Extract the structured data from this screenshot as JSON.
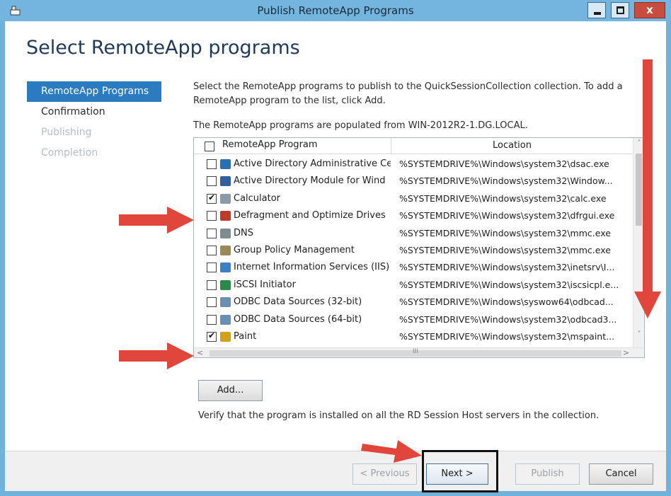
{
  "window": {
    "title": "Publish RemoteApp Programs",
    "close_glyph": "x"
  },
  "page": {
    "heading": "Select RemoteApp programs"
  },
  "nav": {
    "items": [
      {
        "label": "RemoteApp Programs",
        "state": "selected"
      },
      {
        "label": "Confirmation",
        "state": "normal"
      },
      {
        "label": "Publishing",
        "state": "disabled"
      },
      {
        "label": "Completion",
        "state": "disabled"
      }
    ]
  },
  "content": {
    "description": "Select the RemoteApp programs to publish to the QuickSessionCollection collection. To add a RemoteApp program to the list, click Add.",
    "populated_from": "The RemoteApp programs are populated from WIN-2012R2-1.DG.LOCAL.",
    "verify_note": "Verify that the program is installed on all the RD Session Host servers in the collection."
  },
  "table": {
    "columns": [
      "RemoteApp Program",
      "Location"
    ],
    "rows": [
      {
        "name": "Active Directory Administrative Ce",
        "location": "%SYSTEMDRIVE%\\Windows\\system32\\dsac.exe",
        "checked": false,
        "icon": "ad-admin-center-icon",
        "icon_color": "#2b6fb6"
      },
      {
        "name": "Active Directory Module for Wind",
        "location": "%SYSTEMDRIVE%\\Windows\\system32\\Window...",
        "checked": false,
        "icon": "powershell-module-icon",
        "icon_color": "#2f5f9e"
      },
      {
        "name": "Calculator",
        "location": "%SYSTEMDRIVE%\\Windows\\system32\\calc.exe",
        "checked": true,
        "icon": "calculator-icon",
        "icon_color": "#8a9aa8"
      },
      {
        "name": "Defragment and Optimize Drives",
        "location": "%SYSTEMDRIVE%\\Windows\\system32\\dfrgui.exe",
        "checked": false,
        "icon": "defrag-icon",
        "icon_color": "#c0392b"
      },
      {
        "name": "DNS",
        "location": "%SYSTEMDRIVE%\\Windows\\system32\\mmc.exe",
        "checked": false,
        "icon": "dns-icon",
        "icon_color": "#7f8c8d"
      },
      {
        "name": "Group Policy Management",
        "location": "%SYSTEMDRIVE%\\Windows\\system32\\mmc.exe",
        "checked": false,
        "icon": "group-policy-icon",
        "icon_color": "#9a8a5a"
      },
      {
        "name": "Internet Information Services (IIS)",
        "location": "%SYSTEMDRIVE%\\Windows\\system32\\inetsrv\\I...",
        "checked": false,
        "icon": "iis-icon",
        "icon_color": "#3b7fc4"
      },
      {
        "name": "iSCSI Initiator",
        "location": "%SYSTEMDRIVE%\\Windows\\system32\\iscsicpl.e...",
        "checked": false,
        "icon": "iscsi-icon",
        "icon_color": "#2a8a4a"
      },
      {
        "name": "ODBC Data Sources (32-bit)",
        "location": "%SYSTEMDRIVE%\\Windows\\syswow64\\odbcad...",
        "checked": false,
        "icon": "odbc-icon",
        "icon_color": "#6a8fb0"
      },
      {
        "name": "ODBC Data Sources (64-bit)",
        "location": "%SYSTEMDRIVE%\\Windows\\system32\\odbcad3...",
        "checked": false,
        "icon": "odbc-icon",
        "icon_color": "#6a8fb0"
      },
      {
        "name": "Paint",
        "location": "%SYSTEMDRIVE%\\Windows\\system32\\mspaint...",
        "checked": true,
        "icon": "paint-icon",
        "icon_color": "#d4a017"
      }
    ]
  },
  "scroll": {
    "up_glyph": "˄",
    "down_glyph": "˅",
    "left_glyph": "<",
    "right_glyph": ">",
    "grip": "III"
  },
  "buttons": {
    "add": "Add...",
    "previous": "< Previous",
    "next": "Next >",
    "publish": "Publish",
    "cancel": "Cancel"
  },
  "colors": {
    "title_bar": "#73b5de",
    "nav_selected": "#2a7bbf",
    "annotation_arrow": "#e0463b"
  }
}
